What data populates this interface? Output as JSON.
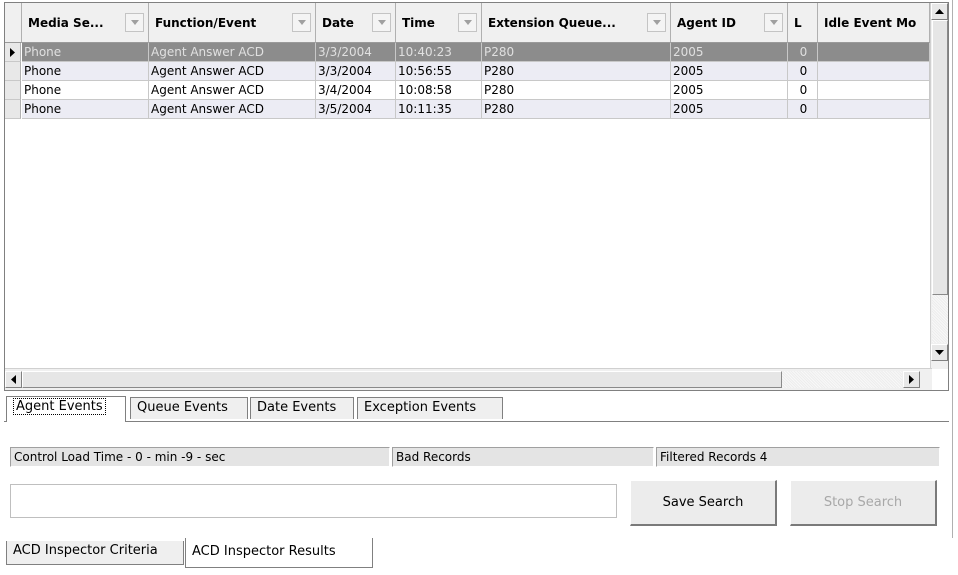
{
  "columns": [
    {
      "label": "Media Se..."
    },
    {
      "label": "Function/Event"
    },
    {
      "label": "Date"
    },
    {
      "label": "Time"
    },
    {
      "label": "Extension Queue..."
    },
    {
      "label": "Agent ID"
    },
    {
      "label": "L"
    },
    {
      "label": "Idle Event Mo"
    }
  ],
  "rows": [
    {
      "media": "Phone",
      "function": "Agent Answer ACD",
      "date": "3/3/2004",
      "time": "10:40:23",
      "extension": "P280",
      "agent": "2005",
      "l": "0",
      "idle": "",
      "selected": true
    },
    {
      "media": "Phone",
      "function": "Agent Answer ACD",
      "date": "3/3/2004",
      "time": "10:56:55",
      "extension": "P280",
      "agent": "2005",
      "l": "0",
      "idle": ""
    },
    {
      "media": "Phone",
      "function": "Agent Answer ACD",
      "date": "3/4/2004",
      "time": "10:08:58",
      "extension": "P280",
      "agent": "2005",
      "l": "0",
      "idle": ""
    },
    {
      "media": "Phone",
      "function": "Agent Answer ACD",
      "date": "3/5/2004",
      "time": "10:11:35",
      "extension": "P280",
      "agent": "2005",
      "l": "0",
      "idle": ""
    }
  ],
  "event_tabs": [
    "Agent Events",
    "Queue Events",
    "Date Events",
    "Exception Events"
  ],
  "status": {
    "load_time": "Control Load Time - 0 - min -9 - sec",
    "bad_records": "Bad Records",
    "filtered_records": "Filtered Records 4"
  },
  "search": {
    "value": "",
    "placeholder": ""
  },
  "buttons": {
    "save": "Save Search",
    "stop": "Stop Search"
  },
  "bottom_tabs": [
    "ACD Inspector Criteria",
    "ACD Inspector Results"
  ],
  "icons": {
    "row_pointer": "triangle-right-icon",
    "filter": "chevron-down-icon",
    "scroll_up": "up-arrow-icon",
    "scroll_down": "down-arrow-icon",
    "scroll_left": "left-arrow-icon",
    "scroll_right": "right-arrow-icon"
  },
  "colors": {
    "selected_row": "#8c8c8c",
    "alt_row": "#ececf4",
    "header": "#f0f0f0"
  }
}
